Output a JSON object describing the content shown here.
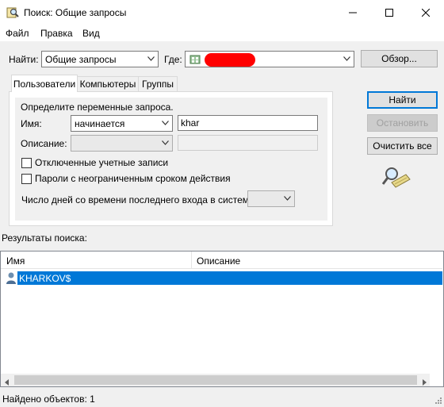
{
  "window": {
    "title": "Поиск: Общие запросы"
  },
  "menu": [
    "Файл",
    "Правка",
    "Вид"
  ],
  "find_bar": {
    "find_label": "Найти:",
    "find_value": "Общие запросы",
    "where_label": "Где:",
    "where_value": "",
    "browse_button": "Обзор..."
  },
  "tabs": [
    "Пользователи",
    "Компьютеры",
    "Группы"
  ],
  "query": {
    "section_label": "Определите переменные запроса.",
    "name_label": "Имя:",
    "name_condition": "начинается",
    "name_value": "khar",
    "description_label": "Описание:",
    "description_condition": "",
    "description_value": "",
    "checkbox_disabled_accounts": "Отключенные учетные записи",
    "checkbox_nonexpiring_passwords": "Пароли с неограниченным сроком действия",
    "days_since_logon_label": "Число дней со времени последнего входа в систему:",
    "days_since_logon_value": ""
  },
  "actions": {
    "find": "Найти",
    "stop": "Остановить",
    "clear_all": "Очистить все"
  },
  "results": {
    "label": "Результаты поиска:",
    "columns": [
      "Имя",
      "Описание"
    ],
    "rows": [
      {
        "name": "KHARKOV$",
        "description": ""
      }
    ]
  },
  "status": {
    "text": "Найдено объектов: 1"
  },
  "colors": {
    "selection": "#0078d7",
    "redaction": "#ff0000"
  }
}
